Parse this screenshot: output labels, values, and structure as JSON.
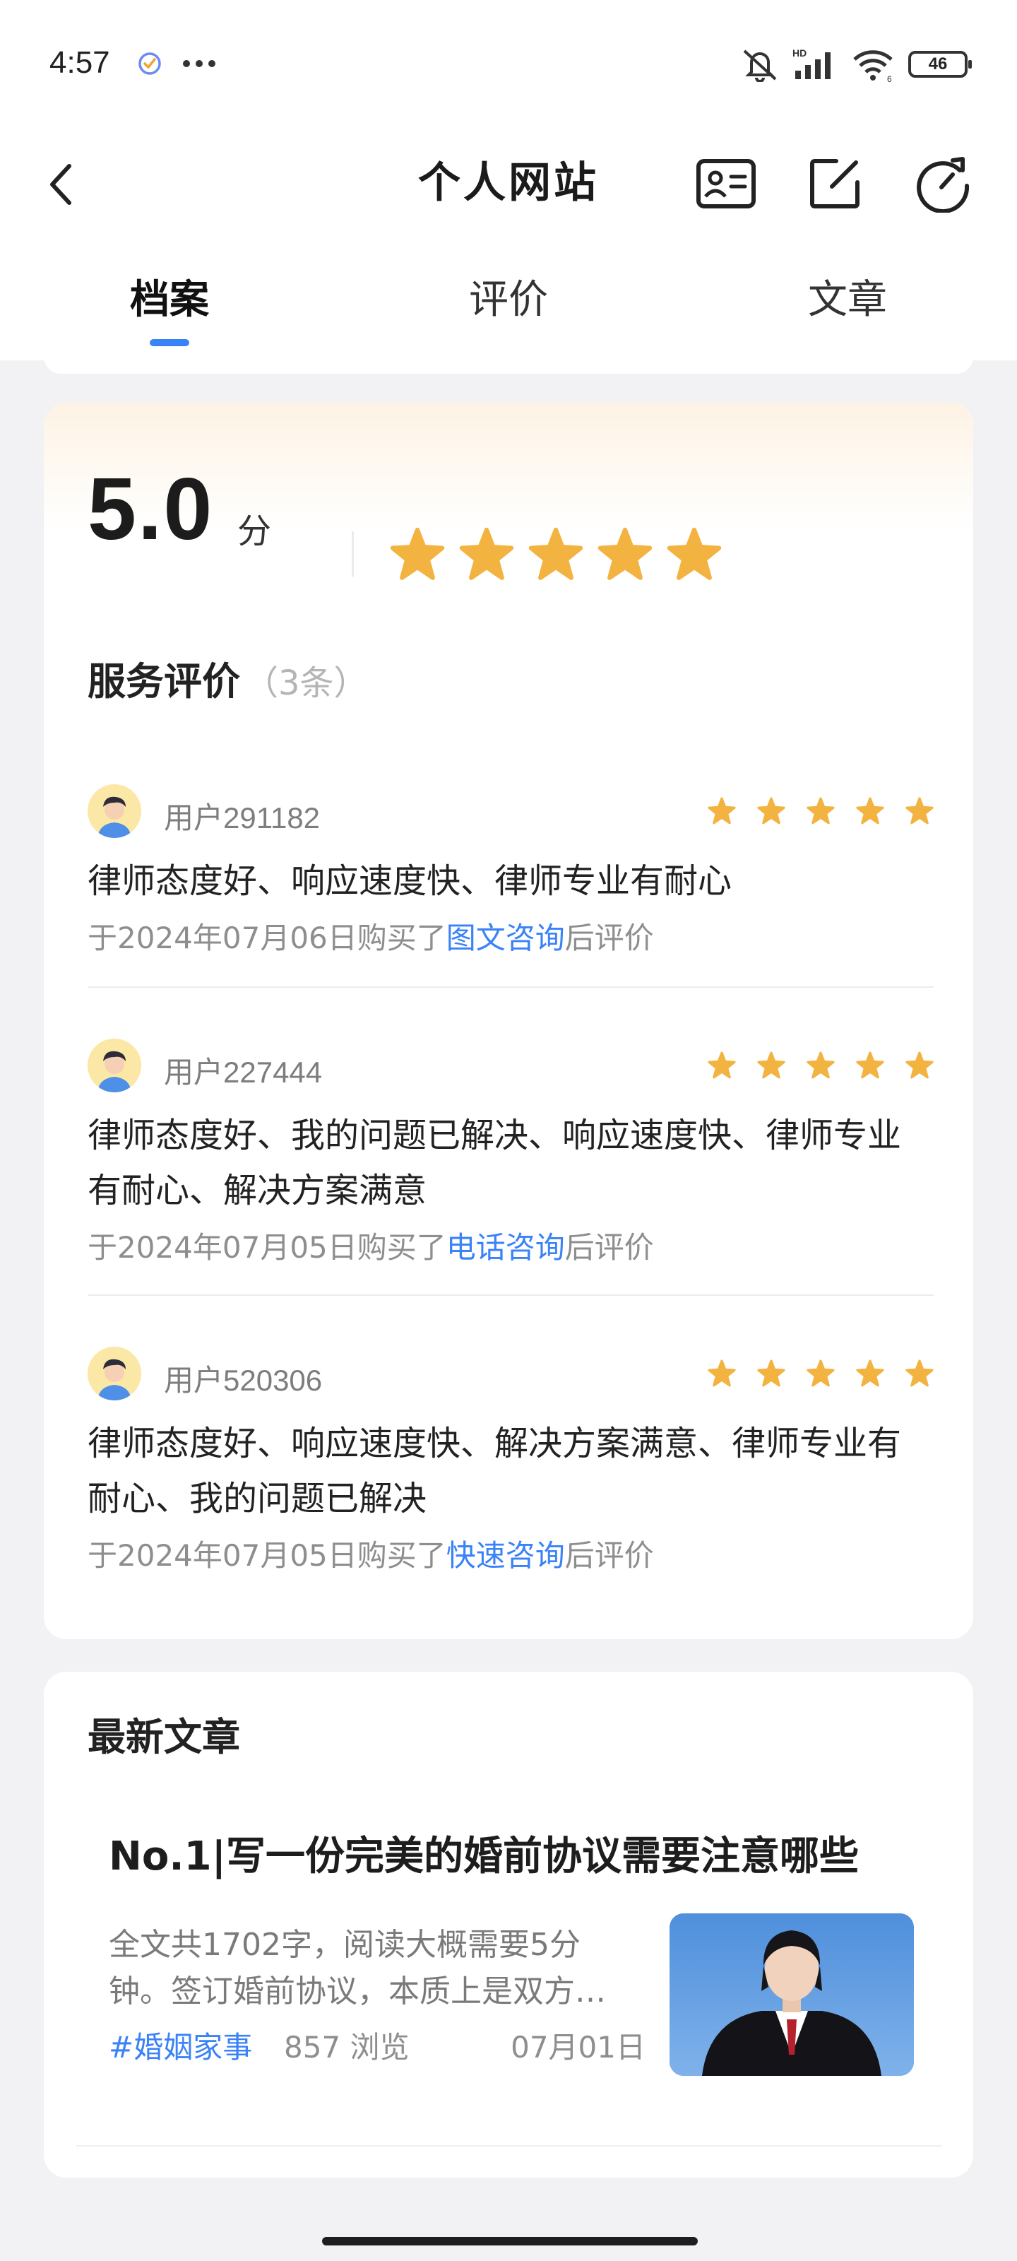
{
  "status_bar": {
    "time": "4:57",
    "battery": "46",
    "icons": [
      "check-badge-icon",
      "more-dots-icon",
      "mute-icon",
      "hd-signal-icon",
      "wifi-icon",
      "battery-icon"
    ]
  },
  "header": {
    "title": "个人网站",
    "actions": [
      "contact-card-icon",
      "edit-icon",
      "refresh-icon"
    ]
  },
  "tabs": [
    {
      "label": "档案",
      "active": true
    },
    {
      "label": "评价",
      "active": false
    },
    {
      "label": "文章",
      "active": false
    }
  ],
  "rating": {
    "score": "5.0",
    "unit": "分",
    "stars": 5,
    "star_color": "#f3b340"
  },
  "reviews_section": {
    "title": "服务评价",
    "count": "（3条）",
    "items": [
      {
        "user": "用户291182",
        "stars": 5,
        "text": "律师态度好、响应速度快、律师专业有耐心",
        "meta_prefix": "于2024年07月06日购买了",
        "meta_link": "图文咨询",
        "meta_suffix": "后评价"
      },
      {
        "user": "用户227444",
        "stars": 5,
        "text": "律师态度好、我的问题已解决、响应速度快、律师专业有耐心、解决方案满意",
        "meta_prefix": "于2024年07月05日购买了",
        "meta_link": "电话咨询",
        "meta_suffix": "后评价"
      },
      {
        "user": "用户520306",
        "stars": 5,
        "text": "律师态度好、响应速度快、解决方案满意、律师专业有耐心、我的问题已解决",
        "meta_prefix": "于2024年07月05日购买了",
        "meta_link": "快速咨询",
        "meta_suffix": "后评价"
      }
    ]
  },
  "articles_section": {
    "title": "最新文章",
    "items": [
      {
        "title": "No.1|写一份完美的婚前协议需要注意哪些",
        "summary": "全文共1702字，阅读大概需要5分钟。签订婚前协议，本质上是双方对财产的约定",
        "tag": "#婚姻家事",
        "views": "857 浏览",
        "date": "07月01日"
      }
    ]
  },
  "colors": {
    "accent": "#3a82f7",
    "star": "#f3b340",
    "background": "#f2f2f4"
  }
}
